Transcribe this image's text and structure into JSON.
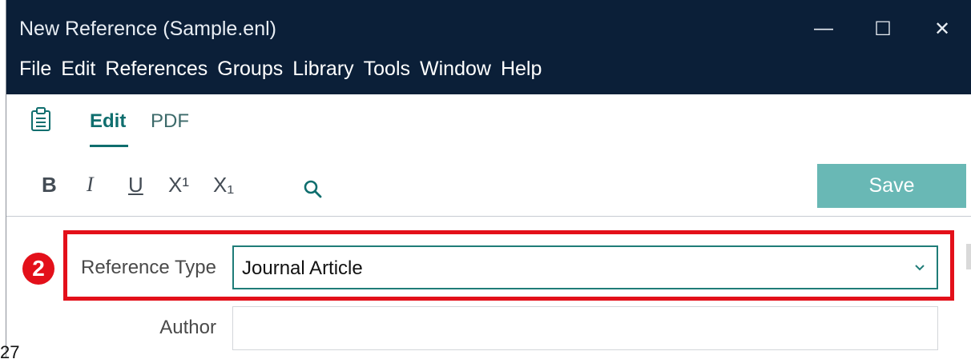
{
  "window": {
    "title": "New Reference (Sample.enl)",
    "controls": {
      "minimize": "—",
      "maximize": "☐",
      "close": "✕"
    }
  },
  "menu": [
    "File",
    "Edit",
    "References",
    "Groups",
    "Library",
    "Tools",
    "Window",
    "Help"
  ],
  "tabs": {
    "active": "Edit",
    "items": [
      "Edit",
      "PDF"
    ]
  },
  "format_toolbar": {
    "bold": "B",
    "italic": "I",
    "underline": "U",
    "superscript": "X¹",
    "subscript": "X₁",
    "search_icon": "search-icon"
  },
  "save_label": "Save",
  "annotation": {
    "badge": "2",
    "highlight_color": "#e3101a"
  },
  "fields": {
    "reference_type": {
      "label": "Reference Type",
      "value": "Journal Article"
    },
    "author": {
      "label": "Author",
      "value": ""
    }
  },
  "stray_text": "27",
  "colors": {
    "titlebar": "#0b1f38",
    "accent": "#0f6e6e",
    "save": "#69b8b5"
  }
}
